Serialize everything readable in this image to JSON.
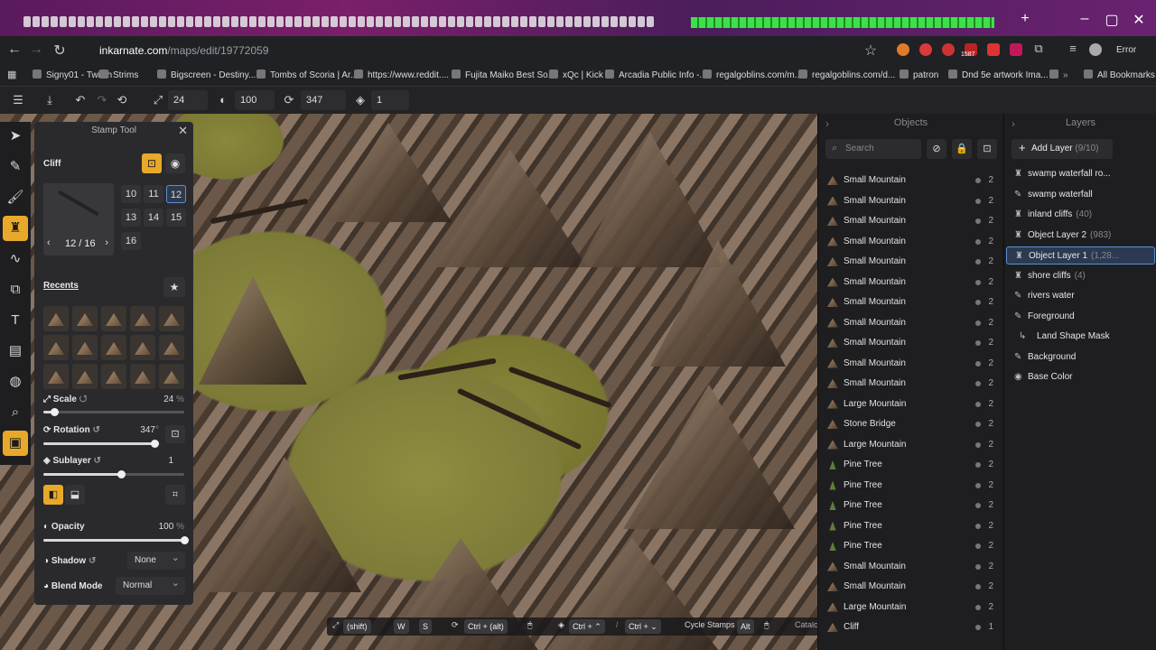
{
  "browser": {
    "url_host": "inkarnate.com",
    "url_path": "/maps/edit/19772059",
    "profile_error": "Error",
    "ext_badge": "1587",
    "bookmarks": [
      "Signy01 - Twitch",
      "Strims",
      "Bigscreen - Destiny...",
      "Tombs of Scoria | Ar...",
      "https://www.reddit....",
      "Fujita Maiko Best So...",
      "xQc | Kick",
      "Arcadia Public Info -...",
      "regalgoblins.com/m...",
      "regalgoblins.com/d...",
      "patron",
      "Dnd 5e artwork Ima..."
    ],
    "all_bookmarks": "All Bookmarks"
  },
  "toolbar": {
    "scale": "24",
    "opacity": "100",
    "rotation": "347",
    "sublayer": "1"
  },
  "stamp_panel": {
    "title": "Stamp Tool",
    "category": "Cliff",
    "variant_counter": "12 / 16",
    "variants": [
      "10",
      "11",
      "12",
      "13",
      "14",
      "15",
      "16"
    ],
    "selected_variant": "12",
    "recents_label": "Recents",
    "scale_label": "Scale",
    "scale_value": "24",
    "scale_unit": "%",
    "scale_fraction": 0.08,
    "rotation_label": "Rotation",
    "rotation_value": "347",
    "rotation_unit": "°",
    "rotation_fraction": 0.96,
    "sublayer_label": "Sublayer",
    "sublayer_value": "1",
    "sublayer_fraction": 0.55,
    "opacity_label": "Opacity",
    "opacity_value": "100",
    "opacity_unit": "%",
    "opacity_fraction": 1.0,
    "shadow_label": "Shadow",
    "shadow_value": "None",
    "blend_label": "Blend Mode",
    "blend_value": "Normal"
  },
  "shortcuts": {
    "shift": "(shift)",
    "w": "W",
    "s": "S",
    "ctrl_alt": "Ctrl + (alt)",
    "ctrl_plus_1": "Ctrl + ⌃",
    "ctrl_plus_2": "Ctrl + ⌄",
    "cycle_label": "Cycle Stamps",
    "alt": "Alt",
    "catalog": "Catalc"
  },
  "objects_panel": {
    "header": "Objects",
    "search_placeholder": "Search",
    "items": [
      {
        "name": "Small Mountain",
        "count": "2",
        "kind": "mountain"
      },
      {
        "name": "Small Mountain",
        "count": "2",
        "kind": "mountain"
      },
      {
        "name": "Small Mountain",
        "count": "2",
        "kind": "mountain"
      },
      {
        "name": "Small Mountain",
        "count": "2",
        "kind": "mountain"
      },
      {
        "name": "Small Mountain",
        "count": "2",
        "kind": "mountain"
      },
      {
        "name": "Small Mountain",
        "count": "2",
        "kind": "mountain"
      },
      {
        "name": "Small Mountain",
        "count": "2",
        "kind": "mountain"
      },
      {
        "name": "Small Mountain",
        "count": "2",
        "kind": "mountain"
      },
      {
        "name": "Small Mountain",
        "count": "2",
        "kind": "mountain"
      },
      {
        "name": "Small Mountain",
        "count": "2",
        "kind": "mountain"
      },
      {
        "name": "Small Mountain",
        "count": "2",
        "kind": "mountain"
      },
      {
        "name": "Large Mountain",
        "count": "2",
        "kind": "mountain"
      },
      {
        "name": "Stone Bridge",
        "count": "2",
        "kind": "mountain"
      },
      {
        "name": "Large Mountain",
        "count": "2",
        "kind": "mountain"
      },
      {
        "name": "Pine Tree",
        "count": "2",
        "kind": "tree"
      },
      {
        "name": "Pine Tree",
        "count": "2",
        "kind": "tree"
      },
      {
        "name": "Pine Tree",
        "count": "2",
        "kind": "tree"
      },
      {
        "name": "Pine Tree",
        "count": "2",
        "kind": "tree"
      },
      {
        "name": "Pine Tree",
        "count": "2",
        "kind": "tree"
      },
      {
        "name": "Small Mountain",
        "count": "2",
        "kind": "mountain"
      },
      {
        "name": "Small Mountain",
        "count": "2",
        "kind": "mountain"
      },
      {
        "name": "Large Mountain",
        "count": "2",
        "kind": "mountain"
      },
      {
        "name": "Cliff",
        "count": "1",
        "kind": "mountain"
      }
    ]
  },
  "layers_panel": {
    "header": "Layers",
    "add_label": "Add Layer",
    "add_count": "(9/10)",
    "items": [
      {
        "name": "swamp waterfall ro...",
        "count": "",
        "icon": "stamp"
      },
      {
        "name": "swamp waterfall",
        "count": "",
        "icon": "brush"
      },
      {
        "name": "inland cliffs",
        "count": "(40)",
        "icon": "stamp"
      },
      {
        "name": "Object Layer 2",
        "count": "(983)",
        "icon": "stamp"
      },
      {
        "name": "Object Layer 1",
        "count": "(1,28...",
        "icon": "stamp",
        "selected": true
      },
      {
        "name": "shore cliffs",
        "count": "(4)",
        "icon": "stamp"
      },
      {
        "name": "rivers water",
        "count": "",
        "icon": "brush"
      },
      {
        "name": "Foreground",
        "count": "",
        "icon": "brush"
      },
      {
        "name": "Land Shape Mask",
        "count": "",
        "icon": "mask"
      },
      {
        "name": "Background",
        "count": "",
        "icon": "brush"
      },
      {
        "name": "Base Color",
        "count": "",
        "icon": "palette"
      }
    ]
  },
  "colors": {
    "accent": "#e8a92b",
    "select_blue": "#5b8fd6"
  }
}
